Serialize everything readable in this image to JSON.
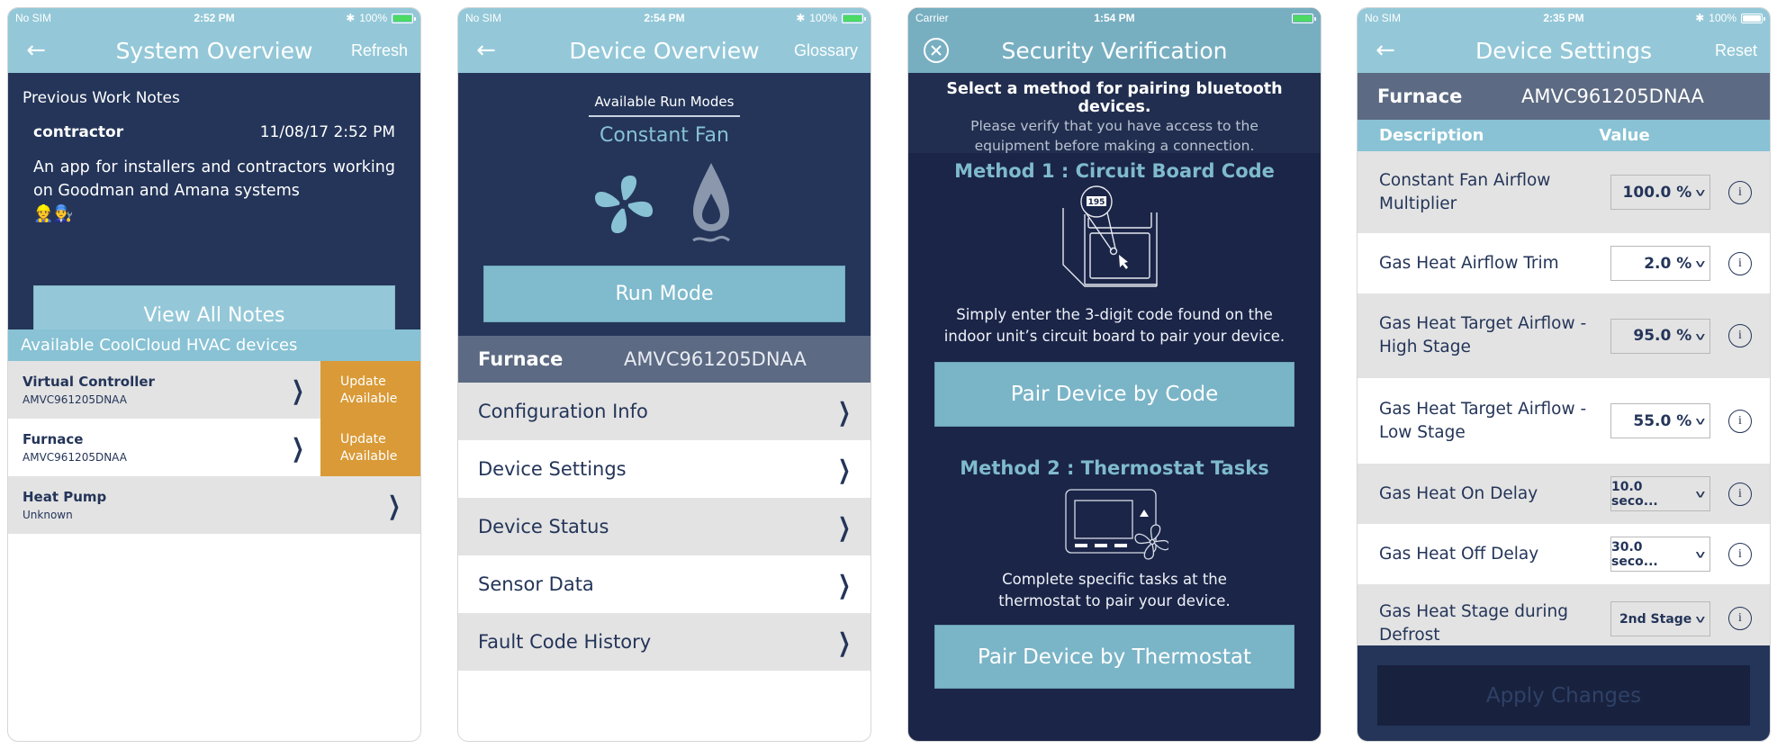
{
  "screens": {
    "system_overview": {
      "status": {
        "carrier": "No SIM",
        "time": "2:52 PM",
        "battery": "100%"
      },
      "nav": {
        "title": "System Overview",
        "action": "Refresh",
        "back_icon": "arrow-left-icon"
      },
      "notes": {
        "heading": "Previous Work Notes",
        "author": "contractor",
        "timestamp": "11/08/17 2:52 PM",
        "body": "An app for installers and contractors working on Goodman and Amana systems",
        "emojis": "👷👨‍🔧"
      },
      "view_all_button": "View All Notes",
      "devices_header": "Available CoolCloud HVAC devices",
      "devices": [
        {
          "name": "Virtual Controller",
          "model": "AMVC961205DNAA",
          "badge": "Update Available"
        },
        {
          "name": "Furnace",
          "model": "AMVC961205DNAA",
          "badge": "Update Available"
        },
        {
          "name": "Heat Pump",
          "model": "Unknown",
          "badge": ""
        }
      ]
    },
    "device_overview": {
      "status": {
        "carrier": "No SIM",
        "time": "2:54 PM",
        "battery": "100%"
      },
      "nav": {
        "title": "Device Overview",
        "action": "Glossary"
      },
      "run_modes_label": "Available Run Modes",
      "current_mode": "Constant Fan",
      "mode_icons": [
        "fan-icon",
        "flame-icon"
      ],
      "run_mode_button": "Run Mode",
      "device": {
        "name": "Furnace",
        "model": "AMVC961205DNAA"
      },
      "menu": [
        "Configuration Info",
        "Device Settings",
        "Device Status",
        "Sensor Data",
        "Fault Code History"
      ]
    },
    "security_verification": {
      "status": {
        "carrier": "Carrier",
        "time": "1:54 PM"
      },
      "nav": {
        "title": "Security Verification",
        "close_icon": "close-circle-icon"
      },
      "intro_bold": "Select a method for pairing bluetooth devices.",
      "intro_sub": "Please verify that you have access to the equipment before making a connection.",
      "method1": {
        "title": "Method 1 : Circuit Board Code",
        "illustration_code": "195",
        "description": "Simply enter the 3-digit code found on the indoor unit’s circuit board to pair your device.",
        "button": "Pair Device by Code"
      },
      "method2": {
        "title": "Method 2 : Thermostat Tasks",
        "description": "Complete specific tasks at the thermostat to pair your device.",
        "button": "Pair Device by Thermostat"
      }
    },
    "device_settings": {
      "status": {
        "carrier": "No SIM",
        "time": "2:35 PM",
        "battery": "100%"
      },
      "nav": {
        "title": "Device Settings",
        "action": "Reset"
      },
      "device": {
        "name": "Furnace",
        "model": "AMVC961205DNAA"
      },
      "columns": {
        "description": "Description",
        "value": "Value"
      },
      "settings": [
        {
          "label": "Constant Fan Airflow Multiplier",
          "value": "100.0 %"
        },
        {
          "label": "Gas Heat Airflow Trim",
          "value": "2.0 %"
        },
        {
          "label": "Gas Heat Target Airflow - High Stage",
          "value": "95.0 %"
        },
        {
          "label": "Gas Heat Target Airflow - Low Stage",
          "value": "55.0 %"
        },
        {
          "label": "Gas Heat On Delay",
          "value": "10.0 seco..."
        },
        {
          "label": "Gas Heat Off Delay",
          "value": "30.0 seco..."
        },
        {
          "label": "Gas Heat Stage during Defrost",
          "value": "2nd Stage"
        }
      ],
      "apply_button": "Apply Changes"
    }
  },
  "colors": {
    "header_light": "#94c8d8",
    "navy": "#243559",
    "accent_orange": "#d99a37",
    "teal_button": "#7fbacd"
  }
}
